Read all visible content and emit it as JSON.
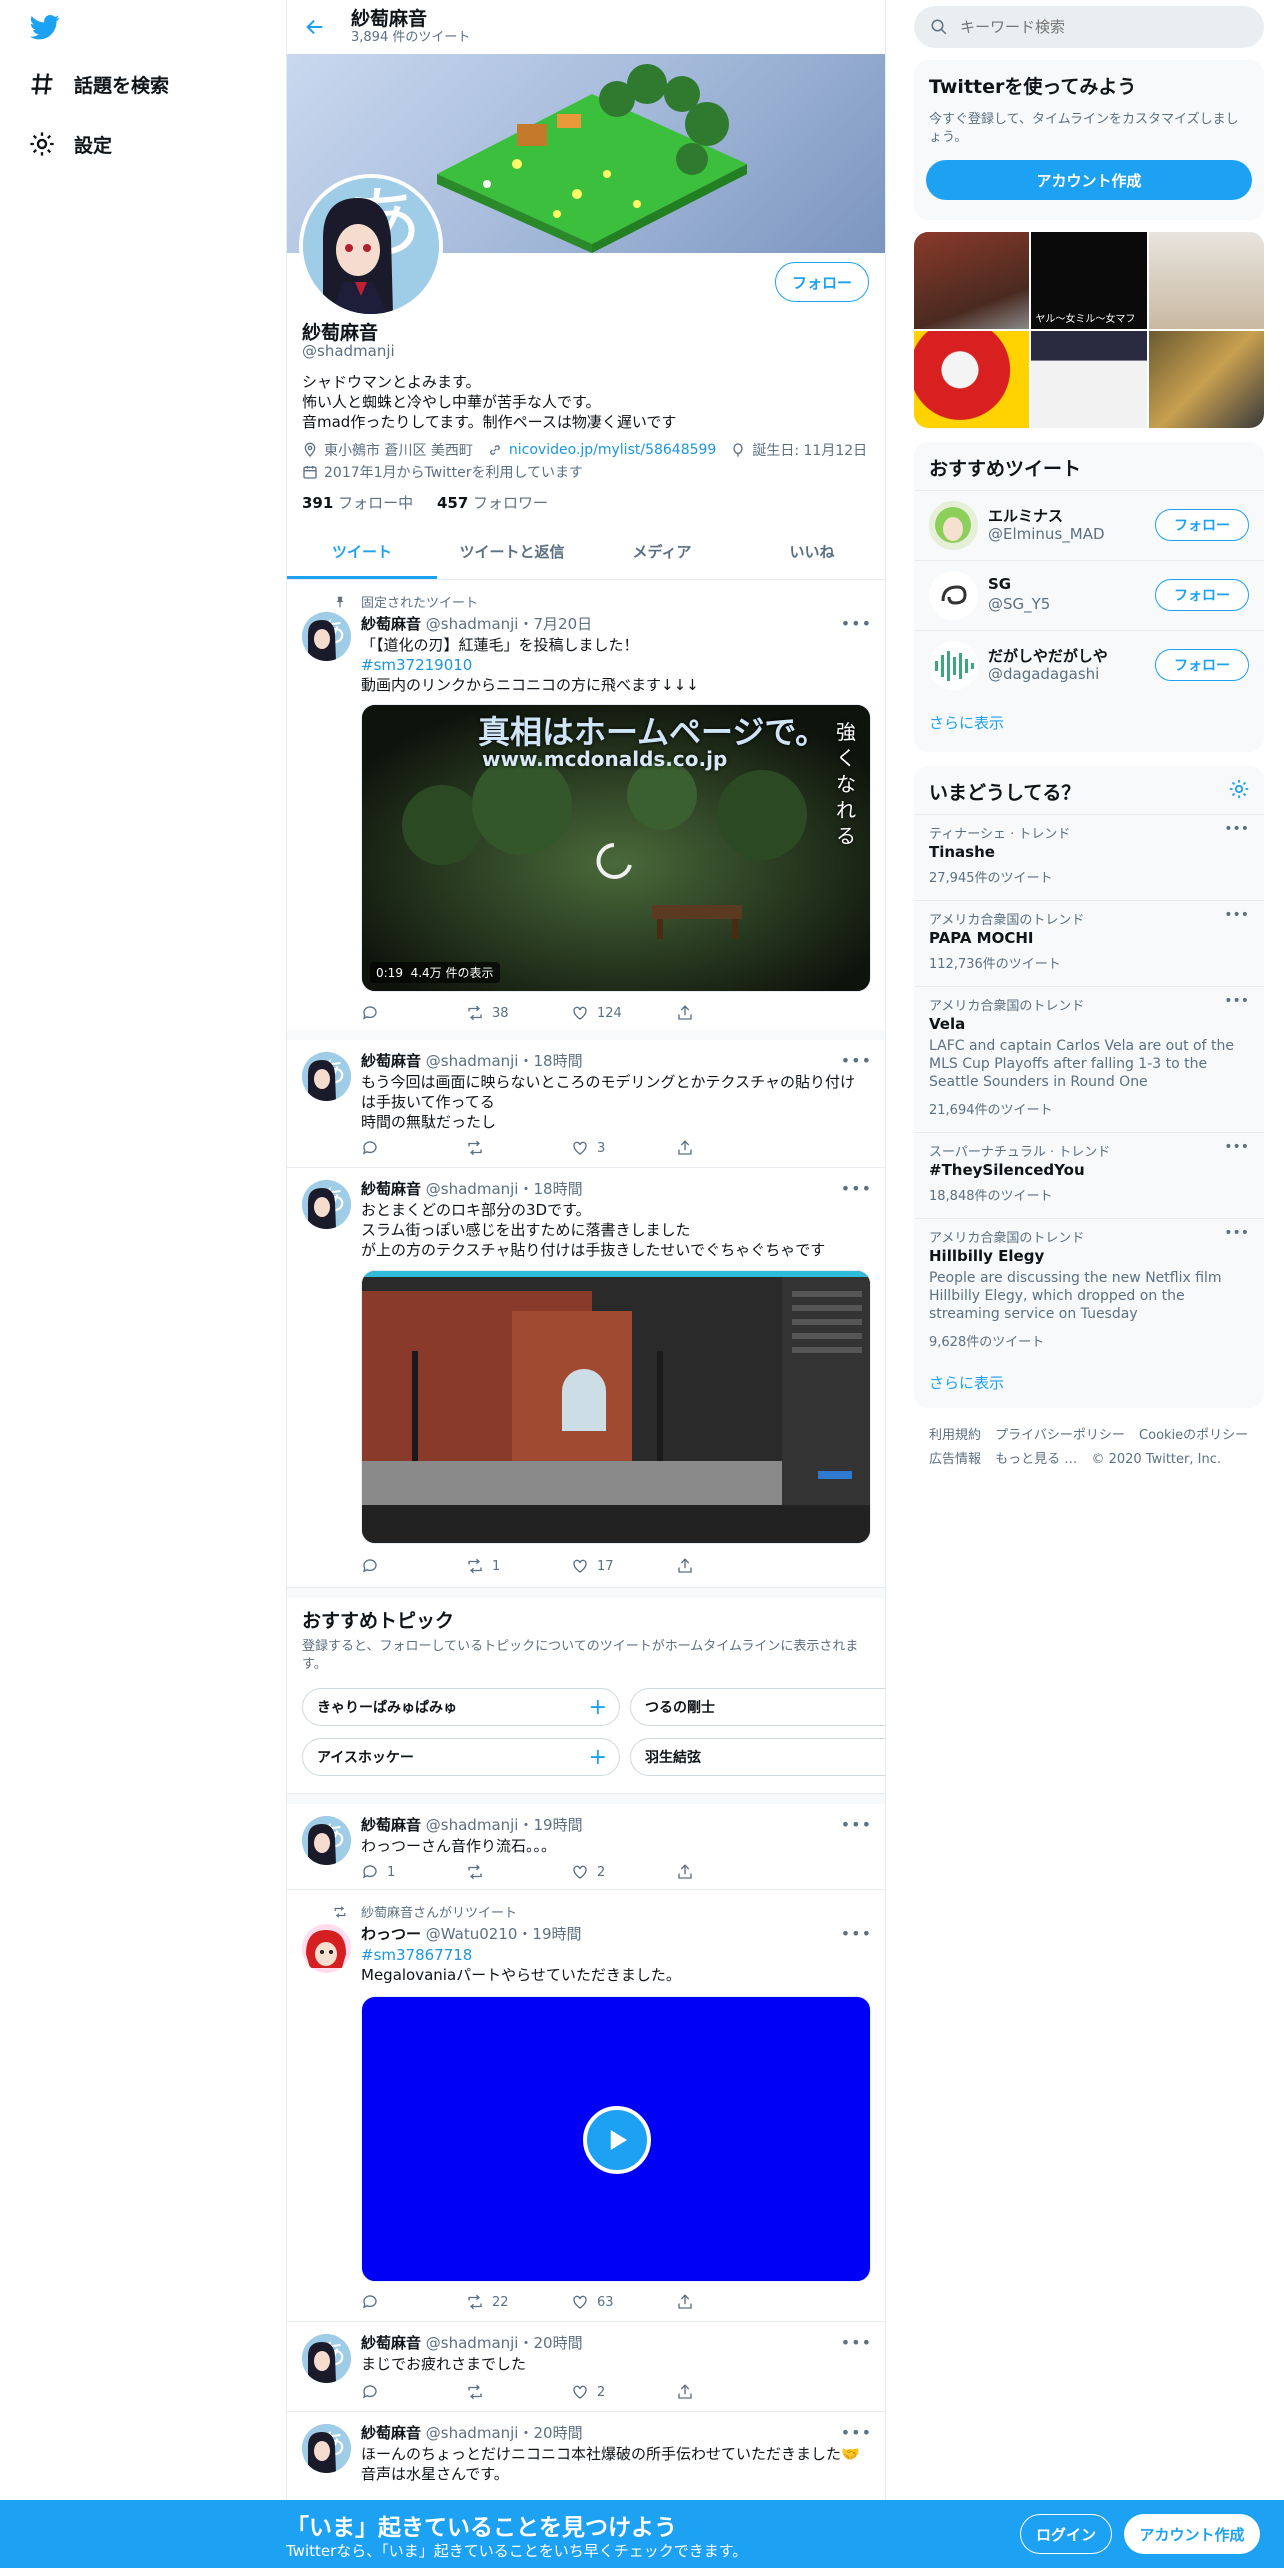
{
  "nav": {
    "explore_label": "話題を検索",
    "settings_label": "設定"
  },
  "header": {
    "title": "紗萄麻音",
    "tweet_count": "3,894 件のツイート"
  },
  "profile": {
    "follow_label": "フォロー",
    "name": "紗萄麻音",
    "handle": "@shadmanji",
    "bio_lines": [
      "シャドウマンとよみます。",
      "怖い人と蜘蛛と冷やし中華が苦手な人です。",
      "音mad作ったりしてます。制作ペースは物凄く遅いです"
    ],
    "location": "東小鵺市 蒼川区 美西町",
    "website": "nicovideo.jp/mylist/58648599",
    "birthday": "誕生日: 11月12日",
    "joined": "2017年1月からTwitterを利用しています",
    "following_count": "391",
    "following_label": "フォロー中",
    "followers_count": "457",
    "followers_label": "フォロワー"
  },
  "tabs": [
    "ツイート",
    "ツイートと返信",
    "メディア",
    "いいね"
  ],
  "tweets": [
    {
      "pinned_label": "固定されたツイート",
      "name": "紗萄麻音",
      "meta": "@shadmanji・7月20日",
      "lines": [
        "「【道化の刃】紅蓮毛」を投稿しました！"
      ],
      "link": "#sm37219010",
      "lines2": [
        "動画内のリンクからニコニコの方に飛べます↓↓↓"
      ],
      "video_caption_top": "真相はホームページで。",
      "video_caption_url": "www.mcdonalds.co.jp",
      "video_caption_side": "強くなれる",
      "video_duration": "0:19",
      "video_views": "4.4万 件の表示",
      "reply": "",
      "retweet": "38",
      "like": "124"
    },
    {
      "name": "紗萄麻音",
      "meta": "@shadmanji・18時間",
      "lines": [
        "もう今回は画面に映らないところのモデリングとかテクスチャの貼り付け",
        "は手抜いて作ってる",
        "時間の無駄だったし"
      ],
      "reply": "",
      "retweet": "",
      "like": "3"
    },
    {
      "name": "紗萄麻音",
      "meta": "@shadmanji・18時間",
      "lines": [
        "おとまくどのロキ部分の3Dです。",
        "スラム街っぽい感じを出すために落書きしました",
        "が上の方のテクスチャ貼り付けは手抜きしたせいでぐちゃぐちゃです"
      ],
      "reply": "",
      "retweet": "1",
      "like": "17"
    }
  ],
  "topics": {
    "title": "おすすめトピック",
    "subtitle": "登録すると、フォローしているトピックについてのツイートがホームタイムラインに表示されます。",
    "items": [
      "きゃりーぱみゅぱみゅ",
      "つるの剛士",
      "アイスホッケー",
      "羽生結弦"
    ]
  },
  "tweets2": [
    {
      "name": "紗萄麻音",
      "meta": "@shadmanji・19時間",
      "lines": [
        "わっつーさん音作り流石。。。"
      ],
      "reply": "1",
      "retweet": "",
      "like": "2"
    },
    {
      "retweet_label": "紗萄麻音さんがリツイート",
      "name": "わっつー",
      "meta": "@Watu0210・19時間",
      "link": "#sm37867718",
      "lines": [
        "Megalovaniaパートやらせていただきました。"
      ],
      "reply": "",
      "retweet": "22",
      "like": "63"
    },
    {
      "name": "紗萄麻音",
      "meta": "@shadmanji・20時間",
      "lines": [
        "まじでお疲れさまでした"
      ],
      "reply": "",
      "retweet": "",
      "like": "2"
    },
    {
      "name": "紗萄麻音",
      "meta": "@shadmanji・20時間",
      "lines": [
        "ほーんのちょっとだけニコニコ本社爆破の所手伝わせていただきました🤝",
        "音声は水星さんです。"
      ]
    }
  ],
  "right": {
    "search_placeholder": "キーワード検索",
    "signup_card_title": "Twitterを使ってみよう",
    "signup_card_sub": "今すぐ登録して、タイムラインをカスタマイズしましょう。",
    "signup_card_btn": "アカウント作成",
    "media_grid_overlay": "ヤル～女ミル～女マフ",
    "recommended_title": "おすすめツイート",
    "recommended": [
      {
        "name": "エルミナス",
        "handle": "@Elminus_MAD",
        "follow": "フォロー"
      },
      {
        "name": "SG",
        "handle": "@SG_Y5",
        "follow": "フォロー"
      },
      {
        "name": "だがしやだがしや",
        "handle": "@dagadagashi",
        "follow": "フォロー"
      }
    ],
    "show_more": "さらに表示",
    "trends_title": "いまどうしてる？",
    "trends": [
      {
        "category": "ティナーシェ · トレンド",
        "name": "Tinashe",
        "desc": "",
        "count": "27,945件のツイート"
      },
      {
        "category": "アメリカ合衆国のトレンド",
        "name": "PAPA MOCHI",
        "desc": "",
        "count": "112,736件のツイート"
      },
      {
        "category": "アメリカ合衆国のトレンド",
        "name": "Vela",
        "desc": "LAFC and captain Carlos Vela are out of the MLS Cup Playoffs after falling 1-3 to the Seattle Sounders in Round One",
        "count": "21,694件のツイート"
      },
      {
        "category": "スーパーナチュラル · トレンド",
        "name": "#TheySilencedYou",
        "desc": "",
        "count": "18,848件のツイート"
      },
      {
        "category": "アメリカ合衆国のトレンド",
        "name": "Hillbilly Elegy",
        "desc": "People are discussing the new Netflix film Hillbilly Elegy, which dropped on the streaming service on Tuesday",
        "count": "9,628件のツイート"
      }
    ],
    "trends_show_more": "さらに表示",
    "footer": [
      "利用規約",
      "プライバシーポリシー",
      "Cookieのポリシー",
      "広告情報",
      "もっと見る …",
      "© 2020 Twitter, Inc."
    ]
  },
  "bottom_bar": {
    "title": "「いま」起きていることを見つけよう",
    "subtitle": "Twitterなら、「いま」起きていることをいち早くチェックできます。",
    "login": "ログイン",
    "signup": "アカウント作成"
  },
  "colors": {
    "accent": "#1da1f2",
    "text": "#0f1419",
    "muted": "#5b7083"
  }
}
